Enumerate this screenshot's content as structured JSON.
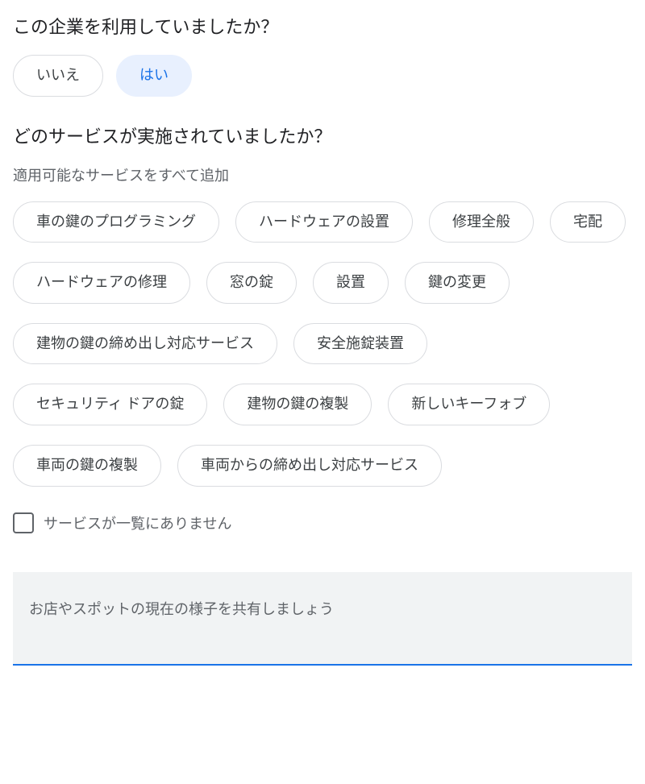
{
  "q1": {
    "title": "この企業を利用していましたか？",
    "no_label": "いいえ",
    "yes_label": "はい",
    "selected": "yes"
  },
  "q2": {
    "title": "どのサービスが実施されていましたか？",
    "subtitle": "適用可能なサービスをすべて追加",
    "services": [
      "車の鍵のプログラミング",
      "ハードウェアの設置",
      "修理全般",
      "宅配",
      "ハードウェアの修理",
      "窓の錠",
      "設置",
      "鍵の変更",
      "建物の鍵の締め出し対応サービス",
      "安全施錠装置",
      "セキュリティ ドアの錠",
      "建物の鍵の複製",
      "新しいキーフォブ",
      "車両の鍵の複製",
      "車両からの締め出し対応サービス"
    ],
    "not_listed_label": "サービスが一覧にありません"
  },
  "share": {
    "prompt": "お店やスポットの現在の様子を共有しましょう"
  }
}
